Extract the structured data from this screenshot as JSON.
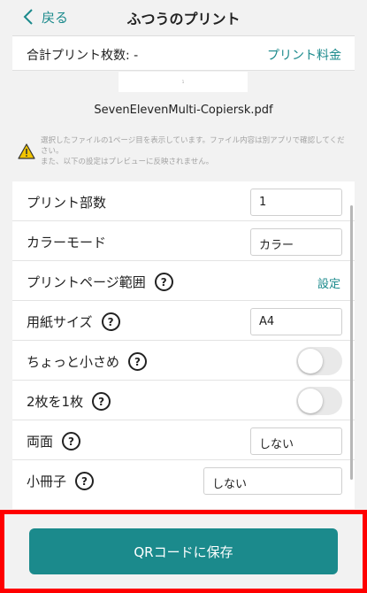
{
  "header": {
    "back_label": "戻る",
    "title": "ふつうのプリント"
  },
  "summary": {
    "count_label": "合計プリント枚数: -",
    "price_link": "プリント料金"
  },
  "preview": {
    "thumb_text": "1",
    "filename": "SevenElevenMulti-Copiersk.pdf",
    "notice": "選択したファイルの1ページ目を表示しています。ファイル内容は別アプリで確認してください。\nまた、以下の設定はプレビューに反映されません。"
  },
  "settings": {
    "copies": {
      "label": "プリント部数",
      "value": "1"
    },
    "color_mode": {
      "label": "カラーモード",
      "value": "カラー"
    },
    "page_range": {
      "label": "プリントページ範囲",
      "action": "設定"
    },
    "paper_size": {
      "label": "用紙サイズ",
      "value": "A4"
    },
    "slightly_smaller": {
      "label": "ちょっと小さめ",
      "enabled": false
    },
    "two_in_one": {
      "label": "2枚を1枚",
      "enabled": false
    },
    "duplex": {
      "label": "両面",
      "value": "しない"
    },
    "booklet": {
      "label": "小冊子",
      "value": "しない"
    },
    "help_glyph": "?"
  },
  "footer": {
    "save_label": "QRコードに保存"
  },
  "colors": {
    "accent": "#1b8a8c",
    "highlight": "#ff0000"
  }
}
